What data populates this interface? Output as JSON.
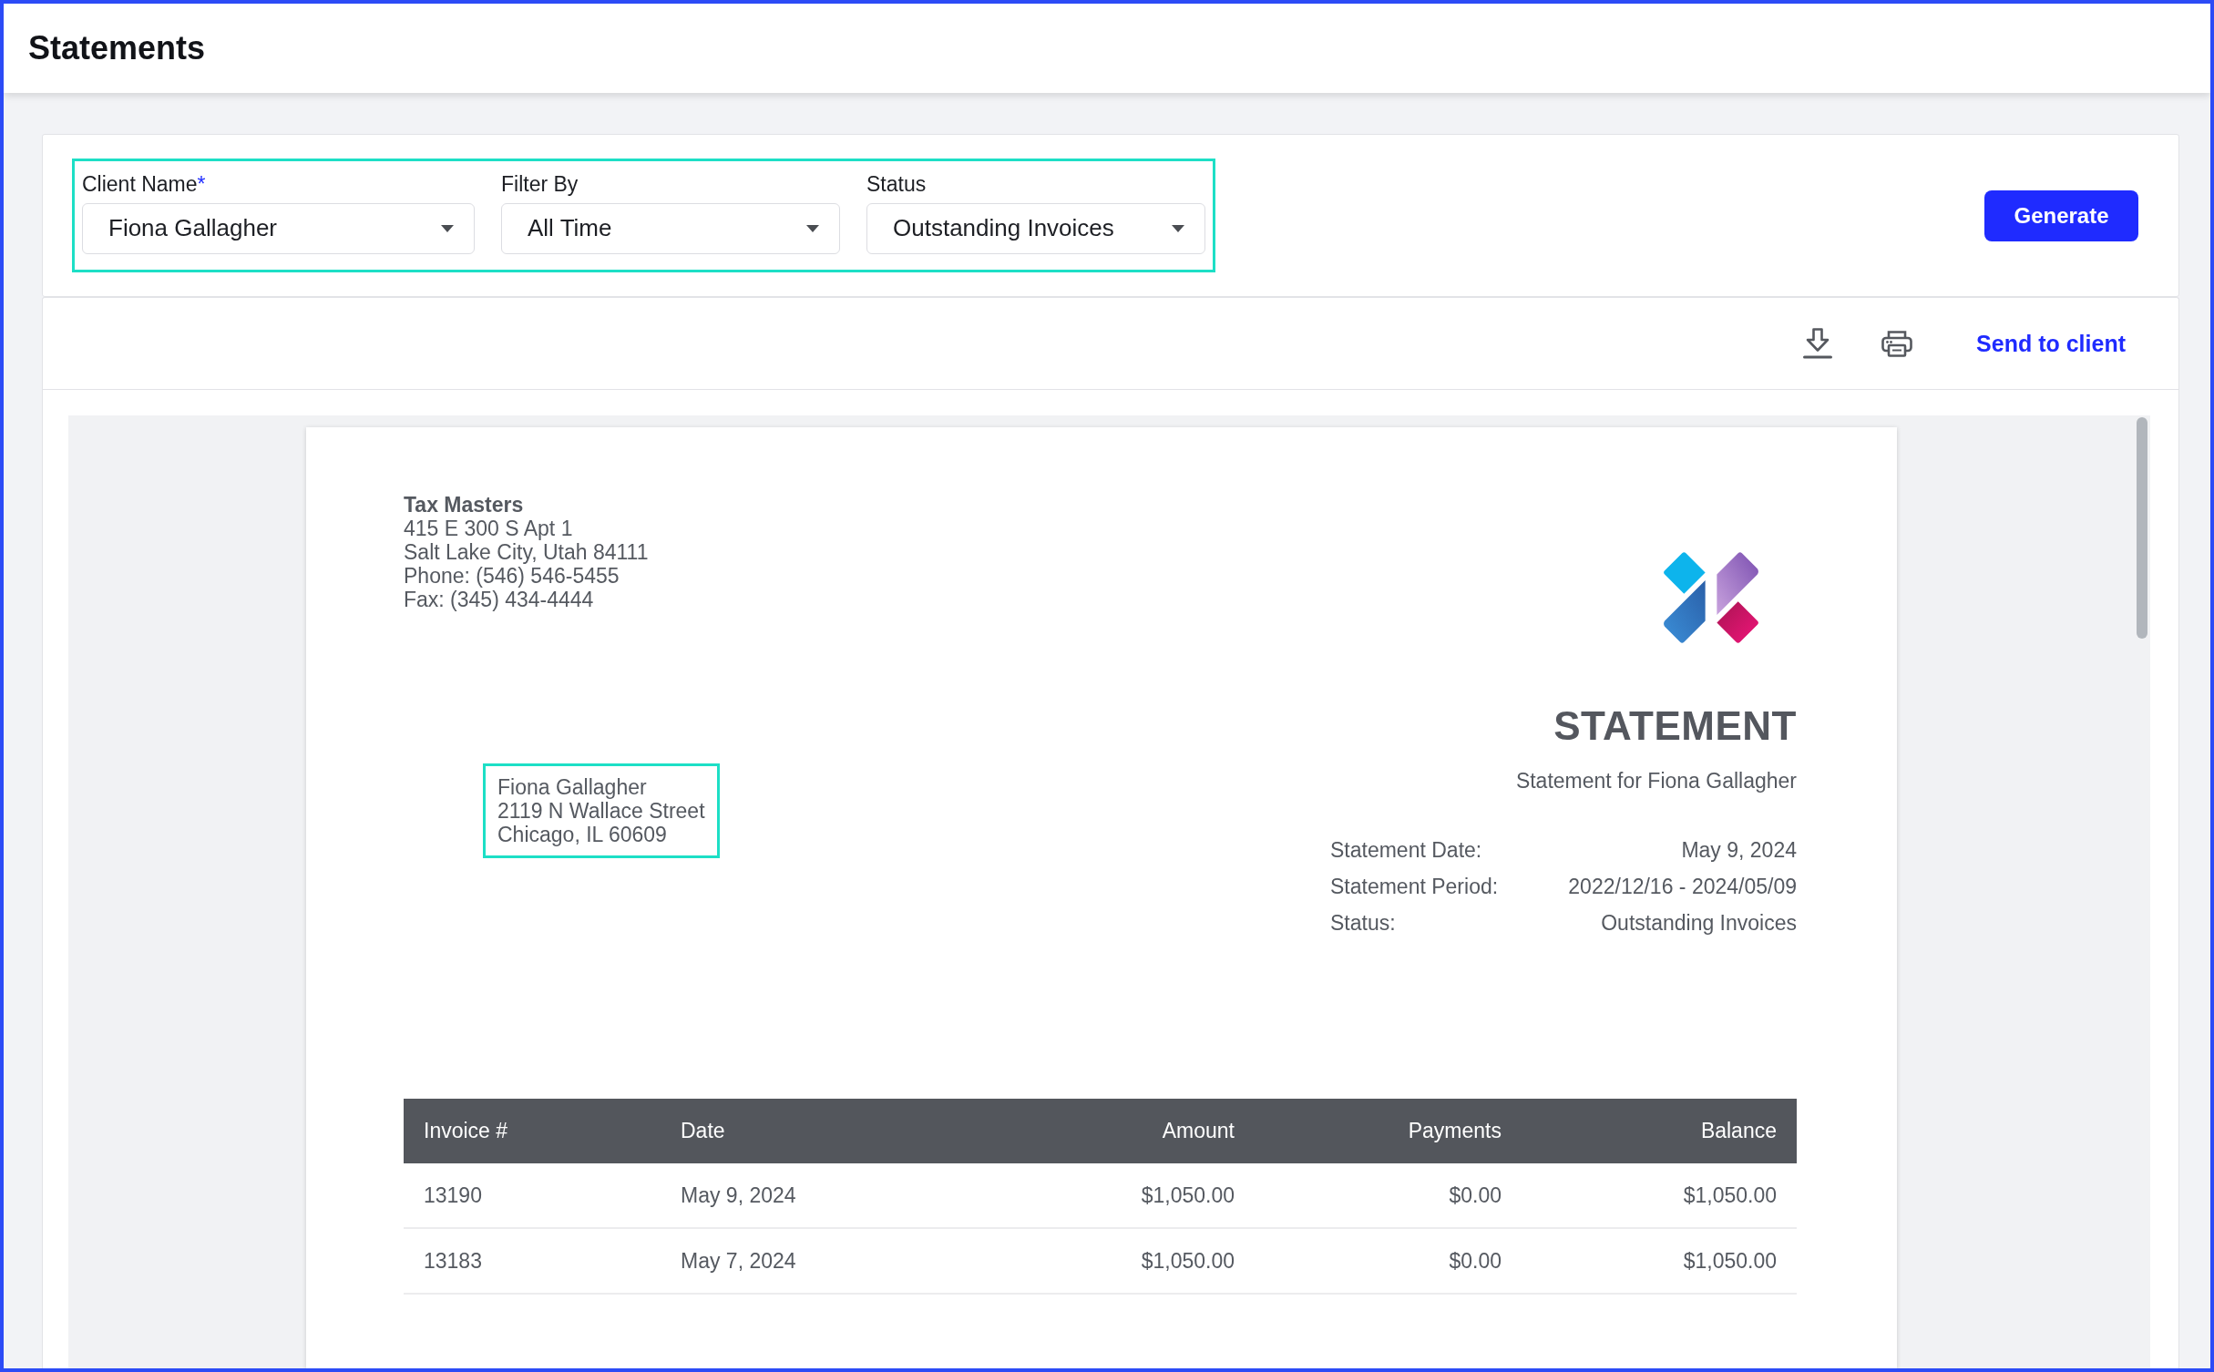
{
  "header": {
    "title": "Statements"
  },
  "filter_panel": {
    "highlighted": true,
    "fields": [
      {
        "label": "Client Name",
        "required_mark": "*",
        "value": "Fiona Gallagher"
      },
      {
        "label": "Filter By",
        "value": "All Time"
      },
      {
        "label": "Status",
        "value": "Outstanding Invoices"
      }
    ]
  },
  "generate_button": {
    "label": "Generate"
  },
  "toolbar": {
    "send_label": "Send to client"
  },
  "statement": {
    "sender": {
      "name": "Tax Masters",
      "lines": [
        "415 E 300 S Apt 1",
        "Salt Lake City, Utah 84111",
        "Phone: (546) 546-5455",
        "Fax: (345) 434-4444"
      ]
    },
    "recipient": {
      "highlighted": true,
      "lines": [
        "Fiona Gallagher",
        "2119 N Wallace Street",
        "Chicago, IL 60609"
      ]
    },
    "title": "STATEMENT",
    "subtitle": "Statement for Fiona Gallagher",
    "details": [
      {
        "label": "Statement Date:",
        "value": "May 9, 2024"
      },
      {
        "label": "Statement Period:",
        "value": "2022/12/16 - 2024/05/09"
      },
      {
        "label": "Status:",
        "value": "Outstanding Invoices"
      }
    ],
    "table": {
      "columns": [
        "Invoice #",
        "Date",
        "Amount",
        "Payments",
        "Balance"
      ],
      "rows": [
        [
          "13190",
          "May 9, 2024",
          "$1,050.00",
          "$0.00",
          "$1,050.00"
        ],
        [
          "13183",
          "May 7, 2024",
          "$1,050.00",
          "$0.00",
          "$1,050.00"
        ]
      ]
    }
  }
}
